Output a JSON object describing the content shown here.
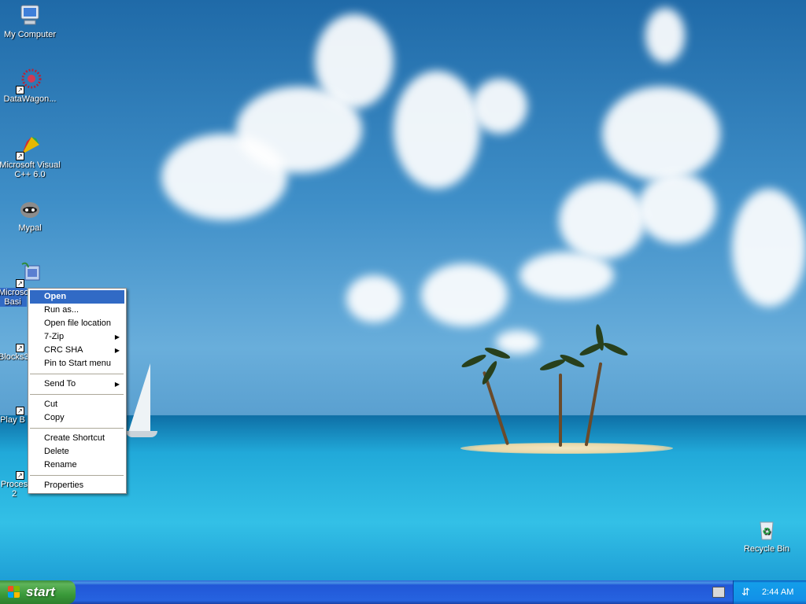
{
  "desktop_icons": [
    {
      "label": "My Computer",
      "icon": "my-computer-icon"
    },
    {
      "label": "DataWagon...",
      "icon": "datawagon-icon"
    },
    {
      "label": "Microsoft Visual C++ 6.0",
      "icon": "visual-cpp-icon"
    },
    {
      "label": "Mypal",
      "icon": "mypal-icon"
    },
    {
      "label": "Microso Basi",
      "icon": "visual-basic-icon"
    },
    {
      "label": "Blocks3",
      "icon": "blocks-icon"
    },
    {
      "label": "Play B",
      "icon": "play-icon"
    },
    {
      "label": "Proces 2",
      "icon": "process-icon"
    },
    {
      "label": "Recycle Bin",
      "icon": "recycle-bin-icon"
    }
  ],
  "context_menu": {
    "items": [
      {
        "label": "Open",
        "highlighted": true
      },
      {
        "label": "Run as..."
      },
      {
        "label": "Open file location"
      },
      {
        "label": "7-Zip",
        "submenu": true
      },
      {
        "label": "CRC SHA",
        "submenu": true
      },
      {
        "label": "Pin to Start menu"
      },
      {
        "label": "Send To",
        "submenu": true
      },
      {
        "label": "Cut"
      },
      {
        "label": "Copy"
      },
      {
        "label": "Create Shortcut"
      },
      {
        "label": "Delete"
      },
      {
        "label": "Rename"
      },
      {
        "label": "Properties"
      }
    ]
  },
  "taskbar": {
    "start_label": "start",
    "clock": "2:44 AM"
  },
  "colors": {
    "selection": "#316ac5",
    "taskbar_blue": "#2663e0",
    "start_green": "#3a9a3a"
  }
}
